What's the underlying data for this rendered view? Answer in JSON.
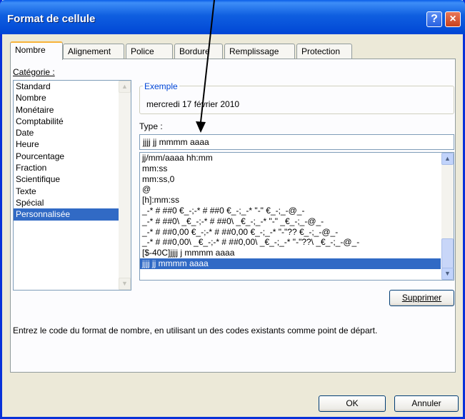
{
  "window": {
    "title": "Format de cellule"
  },
  "tabs": [
    {
      "label": "Nombre"
    },
    {
      "label": "Alignement"
    },
    {
      "label": "Police"
    },
    {
      "label": "Bordure"
    },
    {
      "label": "Remplissage"
    },
    {
      "label": "Protection"
    }
  ],
  "category": {
    "label": "Catégorie :",
    "items": [
      "Standard",
      "Nombre",
      "Monétaire",
      "Comptabilité",
      "Date",
      "Heure",
      "Pourcentage",
      "Fraction",
      "Scientifique",
      "Texte",
      "Spécial",
      "Personnalisée"
    ],
    "selected": "Personnalisée"
  },
  "sample": {
    "label": "Exemple",
    "value": "mercredi 17 février 2010"
  },
  "type": {
    "label": "Type :",
    "value": "jjjj jj mmmm aaaa",
    "items": [
      "jj/mm/aaaa hh:mm",
      "mm:ss",
      "mm:ss,0",
      "@",
      "[h]:mm:ss",
      "_-* # ##0 €_-;-* # ##0 €_-;_-* \"-\" €_-;_-@_-",
      "_-* # ##0\\ _€_-;-* # ##0\\ _€_-;_-* \"-\" _€_-;_-@_-",
      "_-* # ##0,00 €_-;-* # ##0,00 €_-;_-* \"-\"?? €_-;_-@_-",
      "_-* # ##0,00\\ _€_-;-* # ##0,00\\ _€_-;_-* \"-\"??\\ _€_-;_-@_-",
      "[$-40C]jjjj j mmmm aaaa",
      "jjjj jj mmmm aaaa"
    ],
    "selected": "jjjj jj mmmm aaaa"
  },
  "buttons": {
    "delete": "Supprimer",
    "ok": "OK",
    "cancel": "Annuler"
  },
  "description": "Entrez le code du format de nombre, en utilisant un des codes existants comme point de départ.",
  "colors": {
    "title_bar": "#0a5ee8",
    "selection": "#316ac5",
    "accent": "#0046d5"
  }
}
